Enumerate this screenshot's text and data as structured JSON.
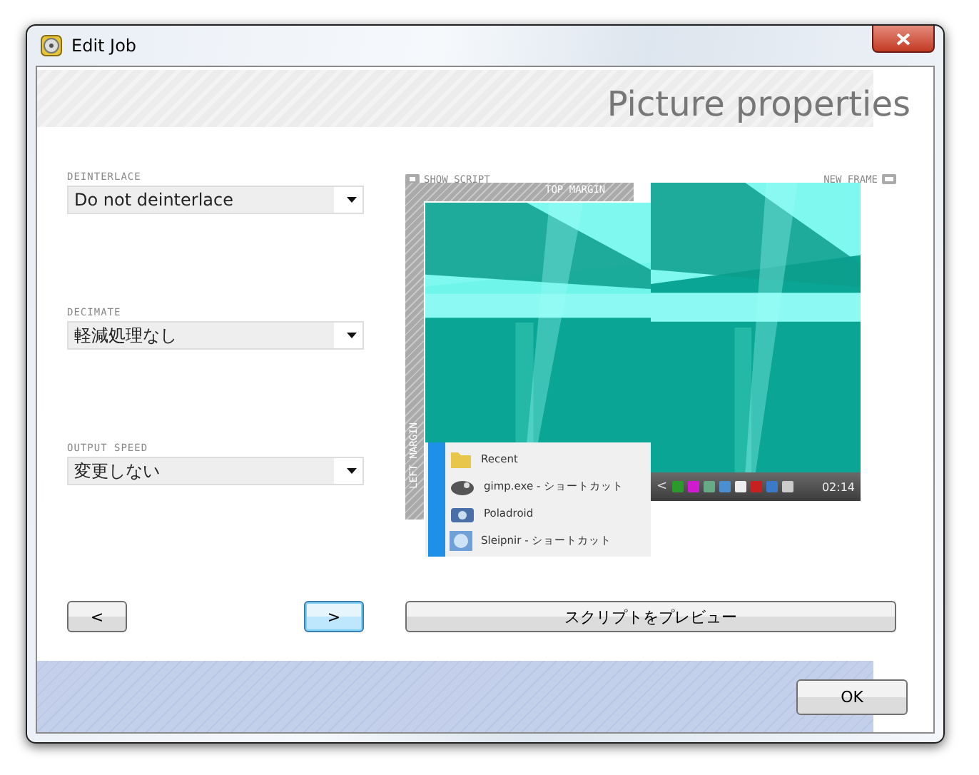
{
  "window": {
    "title": "Edit Job"
  },
  "heading": "Picture properties",
  "fields": [
    {
      "label": "DEINTERLACE",
      "value": "Do not deinterlace"
    },
    {
      "label": "DECIMATE",
      "value": "軽減処理なし"
    },
    {
      "label": "OUTPUT SPEED",
      "value": "変更しない"
    }
  ],
  "preview": {
    "show_script": "SHOW SCRIPT",
    "new_frame": "NEW FRAME",
    "top_margin": "TOP MARGIN",
    "left_margin": "LEFT MARGIN",
    "menu_items": [
      {
        "label": "Recent",
        "kind": "folder"
      },
      {
        "label": "gimp.exe - ショートカット",
        "kind": "app"
      },
      {
        "label": "Poladroid",
        "kind": "camera"
      },
      {
        "label": "Sleipnir - ショートカット",
        "kind": "globe"
      }
    ],
    "taskbar": {
      "chevron": "<",
      "clock": "02:14"
    }
  },
  "buttons": {
    "back": "<",
    "next": ">",
    "preview": "スクリプトをプレビュー",
    "ok": "OK"
  }
}
